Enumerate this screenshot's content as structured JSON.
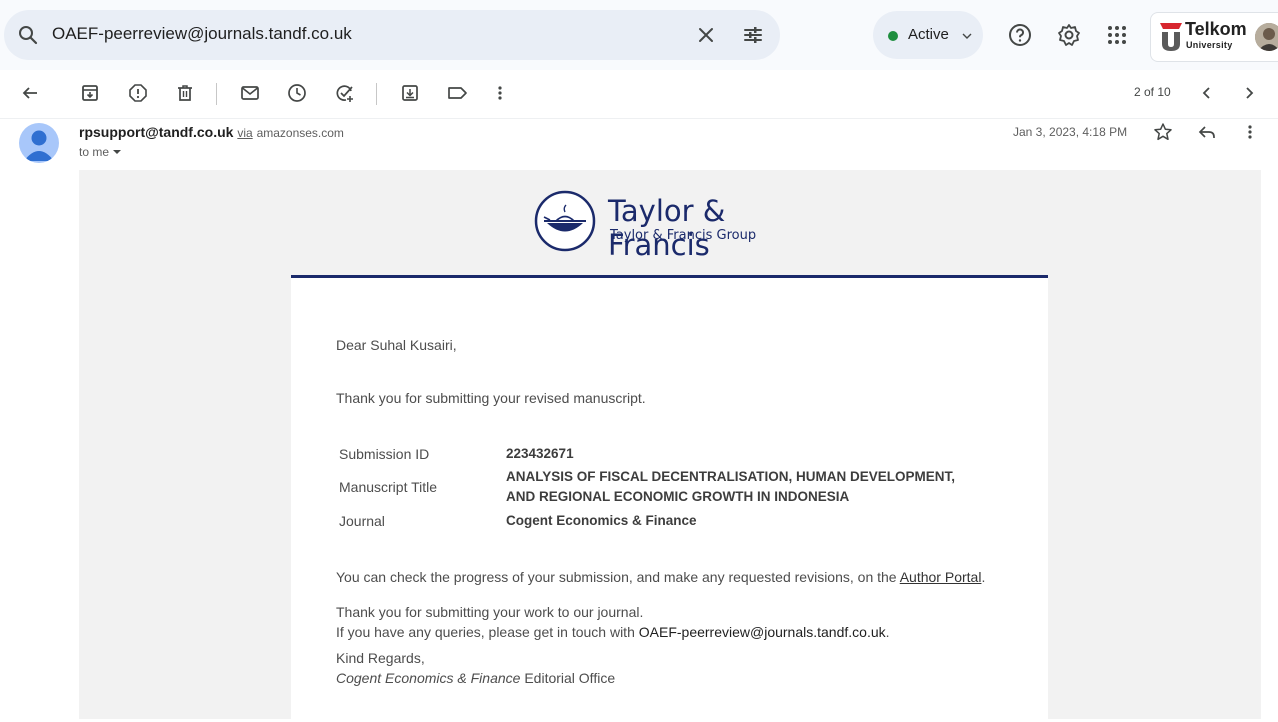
{
  "search": {
    "query": "OAEF-peerreview@journals.tandf.co.uk"
  },
  "status": {
    "label": "Active",
    "color": "#1e8e3e"
  },
  "org": {
    "name": "Telkom",
    "sub": "University"
  },
  "toolbar": {
    "pager": "2 of 10"
  },
  "message": {
    "sender_email": "rpsupport@tandf.co.uk",
    "via_label": "via",
    "via_domain": "amazonses.com",
    "recipient": "to me",
    "date": "Jan 3, 2023, 4:18 PM"
  },
  "logo": {
    "name": "Taylor & Francis",
    "group": "Taylor & Francis Group",
    "brand_color": "#1b2a6b"
  },
  "letter": {
    "greeting": "Dear Suhal Kusairi,",
    "thanks_revised": "Thank you for submitting your revised manuscript.",
    "details": [
      {
        "label": "Submission ID",
        "value": "223432671"
      },
      {
        "label": "Manuscript Title",
        "value_line1": "ANALYSIS OF FISCAL DECENTRALISATION, HUMAN DEVELOPMENT,",
        "value_line2": "AND REGIONAL ECONOMIC GROWTH IN INDONESIA"
      },
      {
        "label": "Journal",
        "value": "Cogent Economics & Finance"
      }
    ],
    "progress_text": "You can check the progress of your submission, and make any requested revisions, on the",
    "portal_link": "Author Portal",
    "thanks_work": "Thank you for submitting your work to our journal.",
    "queries_text": "If you have any queries, please get in touch with",
    "contact_email": "OAEF-peerreview@journals.tandf.co.uk",
    "regards": "Kind Regards,",
    "journal_italic": "Cogent Economics & Finance",
    "office": "Editorial Office"
  }
}
